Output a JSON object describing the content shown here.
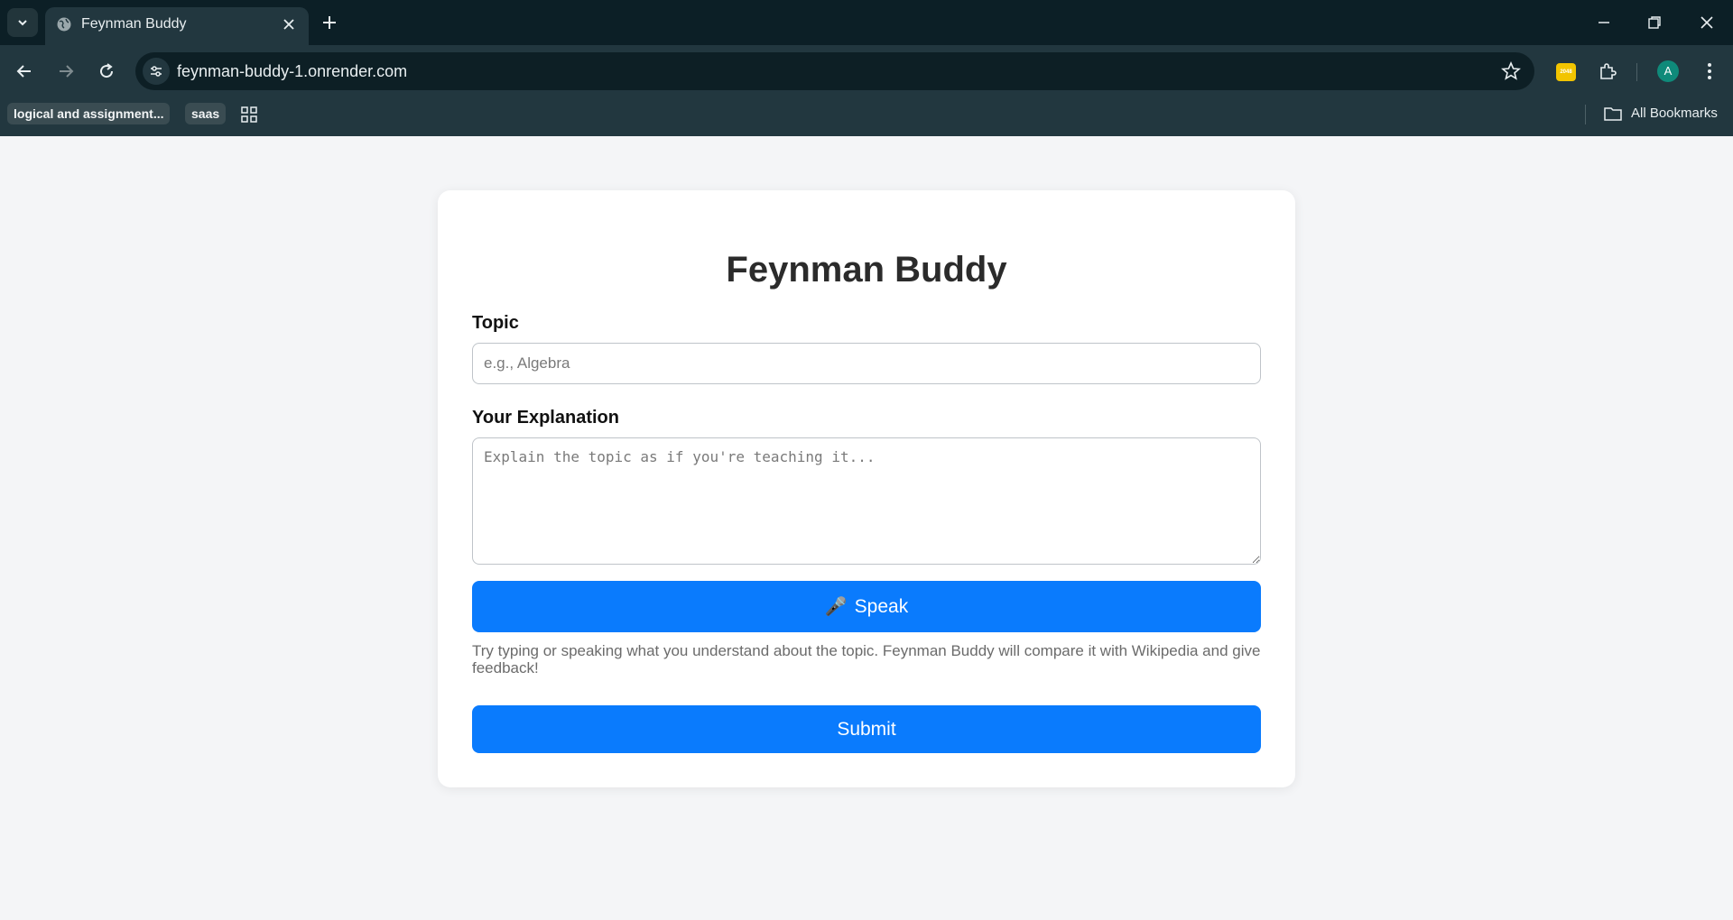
{
  "browser": {
    "tab_title": "Feynman Buddy",
    "url": "feynman-buddy-1.onrender.com",
    "avatar_letter": "A",
    "extension_badge": "2048",
    "bookmarks": [
      {
        "label": "logical and assignment..."
      },
      {
        "label": "saas"
      }
    ],
    "all_bookmarks_label": "All Bookmarks"
  },
  "page": {
    "title": "Feynman Buddy",
    "topic_label": "Topic",
    "topic_placeholder": "e.g., Algebra",
    "explanation_label": "Your Explanation",
    "explanation_placeholder": "Explain the topic as if you're teaching it...",
    "speak_icon": "🎤",
    "speak_label": "Speak",
    "hint": "Try typing or speaking what you understand about the topic. Feynman Buddy will compare it with Wikipedia and give feedback!",
    "submit_label": "Submit"
  },
  "colors": {
    "primary_button": "#0a7bfd",
    "page_background": "#f4f5f7",
    "browser_frame": "#0c1f26"
  }
}
